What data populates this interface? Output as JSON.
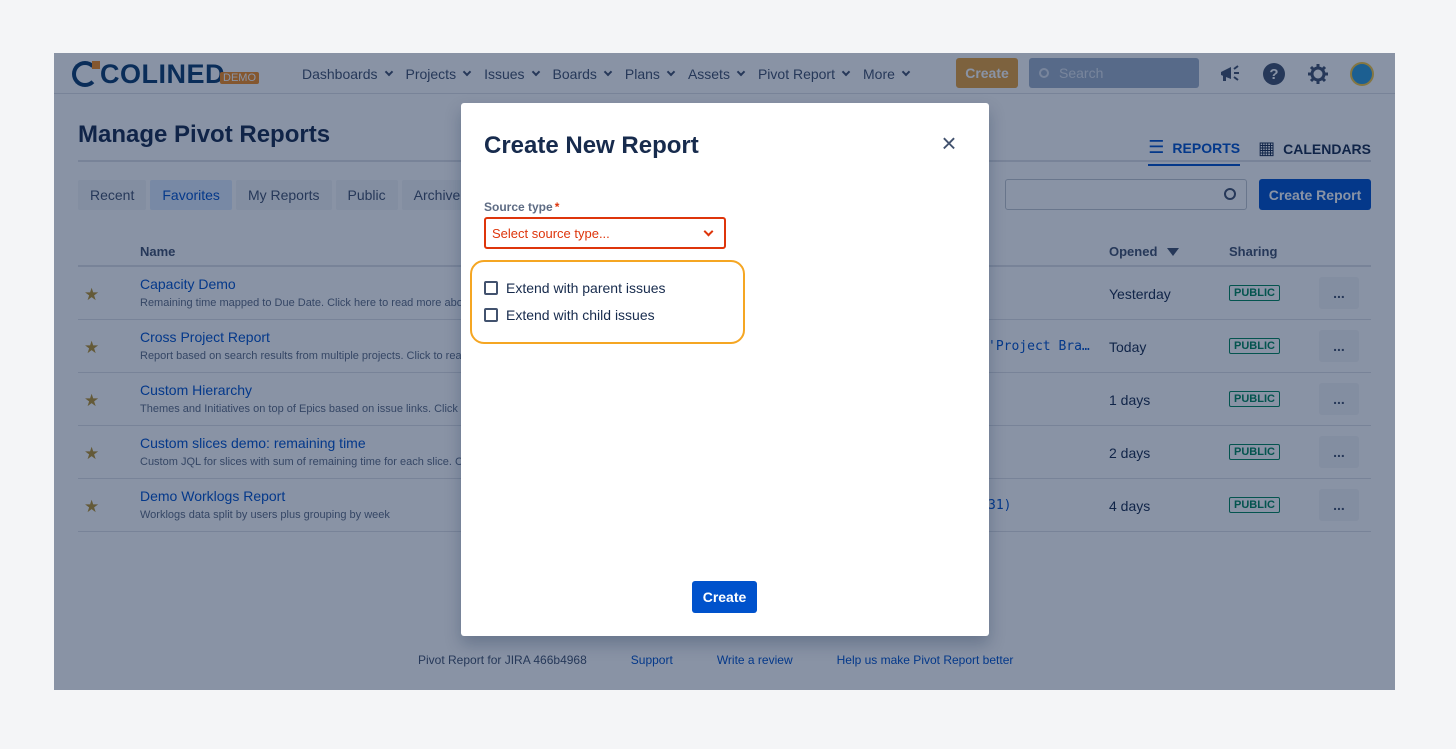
{
  "topnav": {
    "logo_text": "COLINED",
    "logo_badge": "DEMO",
    "items": [
      {
        "label": "Dashboards"
      },
      {
        "label": "Projects"
      },
      {
        "label": "Issues"
      },
      {
        "label": "Boards"
      },
      {
        "label": "Plans"
      },
      {
        "label": "Assets"
      },
      {
        "label": "Pivot Report"
      },
      {
        "label": "More"
      }
    ],
    "create_label": "Create",
    "search_placeholder": "Search"
  },
  "page": {
    "title": "Manage Pivot Reports",
    "view_tabs": [
      {
        "label": "REPORTS",
        "active": true
      },
      {
        "label": "CALENDARS",
        "active": false
      }
    ],
    "filters": [
      {
        "label": "Recent"
      },
      {
        "label": "Favorites"
      },
      {
        "label": "My Reports"
      },
      {
        "label": "Public"
      },
      {
        "label": "Archive"
      }
    ],
    "create_report_label": "Create Report"
  },
  "table": {
    "headers": {
      "name": "Name",
      "opened": "Opened",
      "sharing": "Sharing"
    },
    "rows": [
      {
        "name": "Capacity Demo",
        "desc": "Remaining time mapped to Due Date. Click here to read more abo",
        "jql": "",
        "opened": "Yesterday",
        "sharing": "PUBLIC",
        "more": "..."
      },
      {
        "name": "Cross Project Report",
        "desc": "Report based on search results from multiple projects. Click to rea",
        "jql": "'Project Bra…",
        "opened": "Today",
        "sharing": "PUBLIC",
        "more": "..."
      },
      {
        "name": "Custom Hierarchy",
        "desc": "Themes and Initiatives on top of Epics based on issue links. Click to",
        "jql": "",
        "opened": "1 days",
        "sharing": "PUBLIC",
        "more": "..."
      },
      {
        "name": "Custom slices demo: remaining time",
        "desc": "Custom JQL for slices with sum of remaining time for each slice. Cl",
        "jql": "",
        "opened": "2 days",
        "sharing": "PUBLIC",
        "more": "..."
      },
      {
        "name": "Demo Worklogs Report",
        "desc": "Worklogs data split by users plus grouping by week",
        "jql": "31)",
        "opened": "4 days",
        "sharing": "PUBLIC",
        "more": "..."
      }
    ]
  },
  "footer": {
    "version": "Pivot Report for JIRA 466b4968",
    "support": "Support",
    "review": "Write a review",
    "help": "Help us make Pivot Report better"
  },
  "modal": {
    "title": "Create New Report",
    "close": "×",
    "source_label": "Source type",
    "required_mark": "*",
    "source_placeholder": "Select source type...",
    "checkbox_parent": "Extend with parent issues",
    "checkbox_child": "Extend with child issues",
    "create_label": "Create"
  },
  "colors": {
    "brand_navy": "#0c3c6e",
    "brand_orange": "#f68d1e",
    "primary": "#0052cc",
    "error": "#de350b",
    "highlight": "#f5a623"
  }
}
